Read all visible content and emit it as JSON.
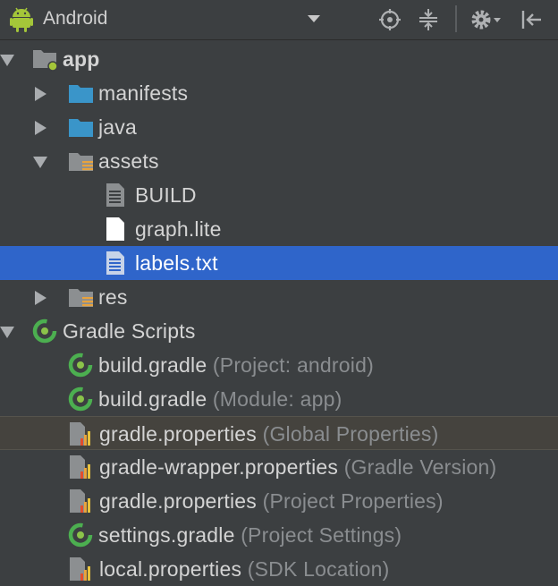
{
  "toolbar": {
    "title": "Android",
    "icons": [
      "android-icon",
      "dropdown-arrow-icon",
      "locate-icon",
      "collapse-all-icon",
      "settings-gear-icon",
      "hide-panel-icon"
    ]
  },
  "tree": [
    {
      "label": "app",
      "bold": true,
      "hint": "",
      "icon": "module-folder-icon",
      "expanded": true
    },
    {
      "label": "manifests",
      "hint": "",
      "icon": "folder-icon",
      "expanded": false
    },
    {
      "label": "java",
      "hint": "",
      "icon": "folder-icon",
      "expanded": false
    },
    {
      "label": "assets",
      "hint": "",
      "icon": "resource-folder-icon",
      "expanded": true
    },
    {
      "label": "BUILD",
      "hint": "",
      "icon": "text-file-icon"
    },
    {
      "label": "graph.lite",
      "hint": "",
      "icon": "blank-file-icon"
    },
    {
      "label": "labels.txt",
      "hint": "",
      "icon": "text-file-icon",
      "selected": true
    },
    {
      "label": "res",
      "hint": "",
      "icon": "resource-folder-icon",
      "expanded": false
    },
    {
      "label": "Gradle Scripts",
      "hint": "",
      "icon": "gradle-icon",
      "expanded": true
    },
    {
      "label": "build.gradle",
      "hint": "(Project: android)",
      "icon": "gradle-icon"
    },
    {
      "label": "build.gradle",
      "hint": "(Module: app)",
      "icon": "gradle-icon"
    },
    {
      "label": "gradle.properties",
      "hint": "(Global Properties)",
      "icon": "properties-file-icon",
      "highlight": true
    },
    {
      "label": "gradle-wrapper.properties",
      "hint": "(Gradle Version)",
      "icon": "properties-file-icon"
    },
    {
      "label": "gradle.properties",
      "hint": "(Project Properties)",
      "icon": "properties-file-icon"
    },
    {
      "label": "settings.gradle",
      "hint": "(Project Settings)",
      "icon": "gradle-icon"
    },
    {
      "label": "local.properties",
      "hint": "(SDK Location)",
      "icon": "properties-file-icon"
    }
  ],
  "colors": {
    "background": "#3c3f41",
    "selection": "#2f65ca",
    "folder_blue": "#3a95c9",
    "android_green": "#a4c639",
    "gradle_green": "#4caf50"
  }
}
